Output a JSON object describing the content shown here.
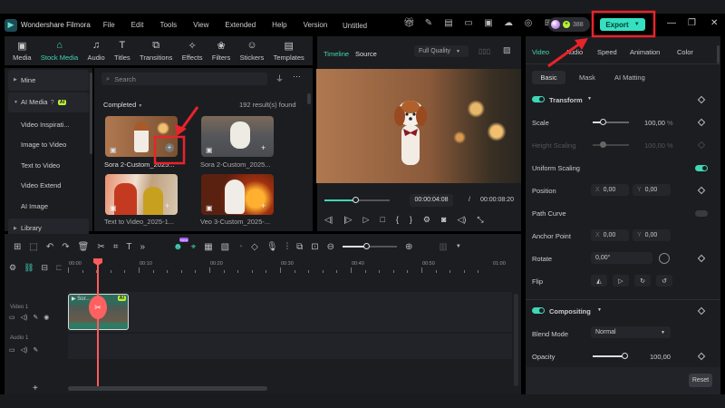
{
  "app": {
    "name": "Wondershare Filmora",
    "title": "Untitled",
    "credits": "388",
    "export_label": "Export"
  },
  "menu": [
    "File",
    "Edit",
    "Tools",
    "View",
    "Extended",
    "Help",
    "Version"
  ],
  "toolbar": [
    "Media",
    "Stock Media",
    "Audio",
    "Titles",
    "Transitions",
    "Effects",
    "Filters",
    "Stickers",
    "Templates"
  ],
  "sidebar": {
    "items": [
      {
        "label": "Mine"
      },
      {
        "label": "AI Media",
        "badge": "AI"
      },
      {
        "label": "Video Inspirati..."
      },
      {
        "label": "Image to Video"
      },
      {
        "label": "Text to Video"
      },
      {
        "label": "Video Extend"
      },
      {
        "label": "AI Image"
      },
      {
        "label": "Library"
      }
    ]
  },
  "library": {
    "search_placeholder": "Search",
    "filter": "Completed",
    "results": "192 result(s) found",
    "items": [
      {
        "caption": "Sora 2-Custom_2025..."
      },
      {
        "caption": "Sora 2-Custom_2025..."
      },
      {
        "caption": "Text to Video_2025-1..."
      },
      {
        "caption": "Veo 3-Custom_2025-..."
      }
    ]
  },
  "preview": {
    "tab_timeline": "Timeline",
    "tab_source": "Source",
    "quality": "Full Quality",
    "current_time": "00:00:04:08",
    "separator": "/",
    "total_time": "00:00:08:20",
    "progress": 0.52
  },
  "inspector": {
    "tabs": [
      "Video",
      "Audio",
      "Speed",
      "Animation",
      "Color"
    ],
    "subtabs": [
      "Basic",
      "Mask",
      "AI Matting"
    ],
    "transform_label": "Transform",
    "scale_label": "Scale",
    "scale_value": "100,00",
    "pct": "%",
    "height_scaling_label": "Height Scaling",
    "height_scaling_value": "100,00",
    "uniform_scaling_label": "Uniform Scaling",
    "position_label": "Position",
    "x_label": "X",
    "y_label": "Y",
    "pos_x": "0,00",
    "pos_y": "0,00",
    "path_curve_label": "Path Curve",
    "anchor_label": "Anchor Point",
    "anchor_x": "0,00",
    "anchor_y": "0,00",
    "rotate_label": "Rotate",
    "rotate_value": "0,00°",
    "flip_label": "Flip",
    "compositing_label": "Compositing",
    "blend_label": "Blend Mode",
    "blend_value": "Normal",
    "opacity_label": "Opacity",
    "opacity_value": "100,00",
    "reset_label": "Reset"
  },
  "timeline": {
    "ruler": [
      "00:00",
      "00:10",
      "00:20",
      "00:30",
      "00:40",
      "00:50",
      "01:00"
    ],
    "video_track": "Video 1",
    "audio_track": "Audio 1",
    "clip_label": "Sor...",
    "clip_badge": "AI",
    "new_badge": "New"
  }
}
